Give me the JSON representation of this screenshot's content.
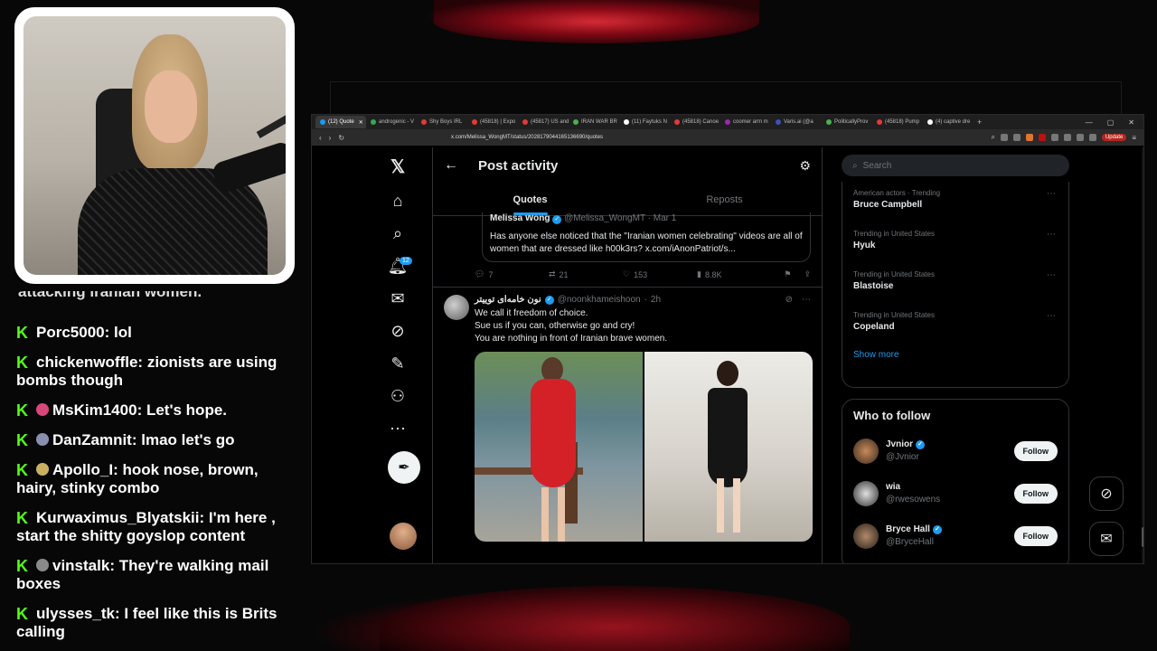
{
  "webcam": {
    "alt": "streamer webcam"
  },
  "chat": {
    "cutoff_text": "attacking iranian women.",
    "messages": [
      {
        "user": "Porc5000",
        "text": "lol",
        "badge": ""
      },
      {
        "user": "chickenwoffle",
        "text": "zionists are using bombs though",
        "badge": ""
      },
      {
        "user": "MsKim1400",
        "text": "Let's hope.",
        "badge": "#d9467a"
      },
      {
        "user": "DanZamnit",
        "text": "lmao let's go",
        "badge": "#8a8fb0"
      },
      {
        "user": "Apollo_I",
        "text": "hook nose, brown, hairy, stinky combo",
        "badge": "#c8b060"
      },
      {
        "user": "Kurwaximus_Blyatskii",
        "text": "I'm here , start the shitty goyslop content",
        "badge": ""
      },
      {
        "user": "vinstalk",
        "text": "They're walking mail boxes",
        "badge": "#8a8a8a"
      },
      {
        "user": "ulysses_tk",
        "text": "I feel like this is Brits calling",
        "badge": ""
      }
    ]
  },
  "browser": {
    "tabs": [
      {
        "label": "(12) Quote",
        "color": "#1d9bf0",
        "active": true
      },
      {
        "label": "androgenic - V",
        "color": "#34a853",
        "active": false
      },
      {
        "label": "Shy Boys IRL",
        "color": "#e53935",
        "active": false
      },
      {
        "label": "(45818) | Expo",
        "color": "#e53935",
        "active": false
      },
      {
        "label": "(45817) US and",
        "color": "#e53935",
        "active": false
      },
      {
        "label": "IRAN WAR BR",
        "color": "#4caf50",
        "active": false
      },
      {
        "label": "(11) Faytuks N",
        "color": "#ffffff",
        "active": false
      },
      {
        "label": "(45818) Canoe",
        "color": "#e53935",
        "active": false
      },
      {
        "label": "coomer arm m",
        "color": "#9c27b0",
        "active": false
      },
      {
        "label": "Varis.ai (@a",
        "color": "#3f51b5",
        "active": false
      },
      {
        "label": "PoliticallyProv",
        "color": "#4caf50",
        "active": false
      },
      {
        "label": "(45818) Pump",
        "color": "#e53935",
        "active": false
      },
      {
        "label": "(4) captive dre",
        "color": "#ffffff",
        "active": false
      }
    ],
    "url": "x.com/Melissa_WongMT/status/2028179044165136690/quotes",
    "update_label": "Update"
  },
  "nav": {
    "notification_count": "12"
  },
  "main": {
    "title": "Post activity",
    "tabs": [
      "Quotes",
      "Reposts"
    ],
    "quoted": {
      "name": "Melissa Wong",
      "handle": "@Melissa_WongMT",
      "date": "Mar 1",
      "text": "Has anyone else noticed that the \"Iranian women celebrating\" videos are all of women that are dressed like h00k3rs? x.com/iAnonPatriot/s..."
    },
    "actions": {
      "replies": "7",
      "reposts": "21",
      "likes": "153",
      "views": "8.8K"
    },
    "tweet": {
      "name": "نون خامه‌ای توییتر",
      "handle": "@noonkhameishoon",
      "time": "2h",
      "line1": "We call it freedom of choice.",
      "line2": "Sue us if you can, otherwise go and cry!",
      "line3": "You are nothing in front of Iranian brave women."
    }
  },
  "right": {
    "search_placeholder": "Search",
    "trends": [
      {
        "category": "American actors · Trending",
        "name": "Bruce Campbell"
      },
      {
        "category": "Trending in United States",
        "name": "Hyuk"
      },
      {
        "category": "Trending in United States",
        "name": "Blastoise"
      },
      {
        "category": "Trending in United States",
        "name": "Copeland"
      }
    ],
    "show_more": "Show more",
    "who_to_follow_title": "Who to follow",
    "follow_label": "Follow",
    "suggestions": [
      {
        "name": "Jvnior",
        "handle": "@Jvnior",
        "verified": true
      },
      {
        "name": "wia",
        "handle": "@rwesowens",
        "verified": false
      },
      {
        "name": "Bryce Hall",
        "handle": "@BryceHall",
        "verified": true
      }
    ]
  }
}
